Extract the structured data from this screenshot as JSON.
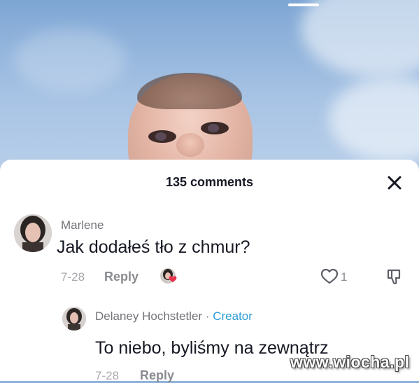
{
  "comments_header": {
    "count_label": "135 comments"
  },
  "comments": [
    {
      "author": "Marlene",
      "text": "Jak dodałeś tło z chmur?",
      "date": "7-28",
      "reply_label": "Reply",
      "likes": "1"
    },
    {
      "author": "Delaney Hochstetler",
      "separator": "·",
      "badge": "Creator",
      "text": "To niebo, byliśmy na zewnątrz",
      "date": "7-28",
      "reply_label": "Reply"
    }
  ],
  "watermark": "www.wiocha.pl",
  "colors": {
    "creator_badge": "#2a9dd8",
    "like_heart": "#e8334d",
    "text_primary": "#161823",
    "text_secondary": "#8a8b91"
  },
  "icons": [
    "close-icon",
    "heart-outline-icon",
    "dislike-icon",
    "creator-liked-heart-icon"
  ]
}
